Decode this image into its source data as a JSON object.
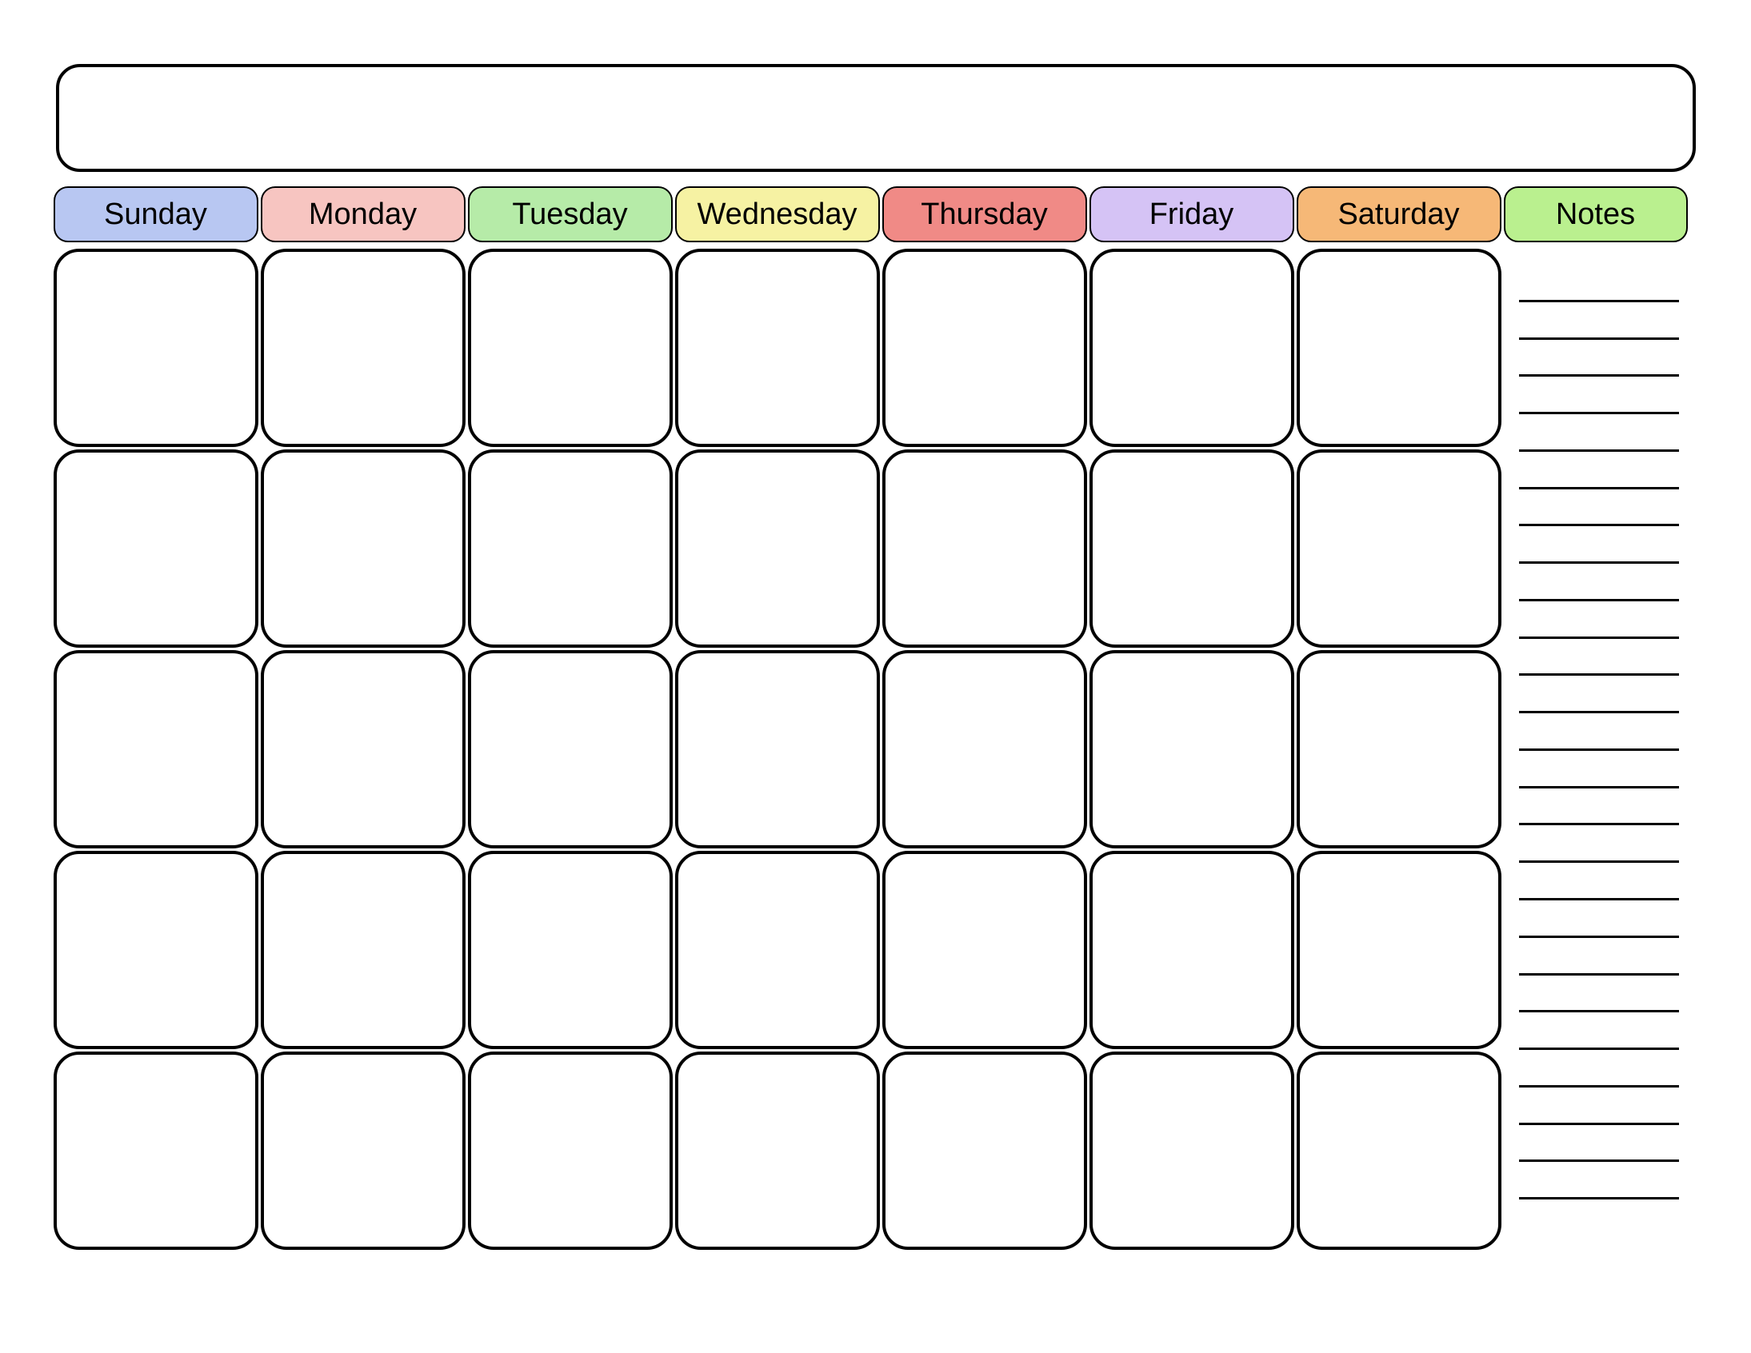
{
  "calendar": {
    "day_headers": [
      {
        "label": "Sunday",
        "color": "#b8c7f2"
      },
      {
        "label": "Monday",
        "color": "#f7c5c1"
      },
      {
        "label": "Tuesday",
        "color": "#b6eba8"
      },
      {
        "label": "Wednesday",
        "color": "#f6f2a3"
      },
      {
        "label": "Thursday",
        "color": "#f08a86"
      },
      {
        "label": "Friday",
        "color": "#d5c3f5"
      },
      {
        "label": "Saturday",
        "color": "#f6b877"
      }
    ],
    "notes_header": {
      "label": "Notes",
      "color": "#baf08f"
    },
    "weeks": 5,
    "days_per_week": 7,
    "note_lines": 25
  }
}
